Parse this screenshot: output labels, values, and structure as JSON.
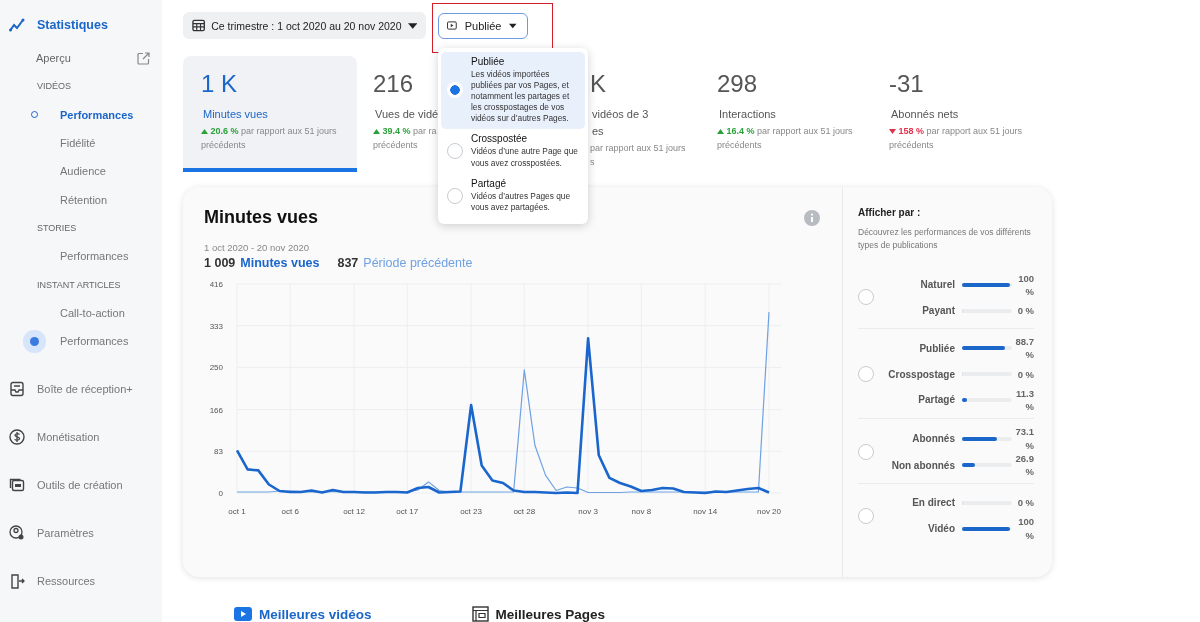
{
  "sidebar": {
    "title": "Statistiques",
    "items": [
      {
        "kind": "link",
        "label": "Aperçu"
      },
      {
        "kind": "section",
        "label": "VIDÉOS"
      },
      {
        "kind": "item",
        "label": "Performances",
        "selected": true,
        "highlighted": false
      },
      {
        "kind": "item",
        "label": "Fidélité",
        "selected": false,
        "highlighted": false
      },
      {
        "kind": "item",
        "label": "Audience",
        "selected": false,
        "highlighted": false
      },
      {
        "kind": "item",
        "label": "Rétention",
        "selected": false,
        "highlighted": false
      },
      {
        "kind": "section",
        "label": "STORIES"
      },
      {
        "kind": "item",
        "label": "Performances",
        "selected": false,
        "highlighted": false
      },
      {
        "kind": "section",
        "label": "INSTANT ARTICLES"
      },
      {
        "kind": "item",
        "label": "Call-to-action",
        "selected": false,
        "highlighted": false
      },
      {
        "kind": "item",
        "label": "Performances",
        "selected": false,
        "highlighted": true
      }
    ],
    "nav": [
      {
        "kind": "inbox",
        "label": "Boîte de réception+"
      },
      {
        "kind": "money",
        "label": "Monétisation"
      },
      {
        "kind": "tools",
        "label": "Outils de création"
      },
      {
        "kind": "settings",
        "label": "Paramètres"
      },
      {
        "kind": "resources",
        "label": "Ressources"
      }
    ]
  },
  "filters": {
    "date_range": "Ce trimestre : 1 oct 2020 au 20 nov 2020",
    "type": "Publiée",
    "type_annotated": true
  },
  "dropdown": {
    "options": [
      {
        "label": "Publiée",
        "description": "Les vidéos importées publiées par vos Pages, et notamment les partages et les crosspostages de vos vidéos sur d’autres Pages.",
        "selected": true
      },
      {
        "label": "Crosspostée",
        "description": "Vidéos d’une autre Page que vous avez crosspostées.",
        "selected": false
      },
      {
        "label": "Partagé",
        "description": "Vidéos d’autres Pages que vous avez partagées.",
        "selected": false
      }
    ]
  },
  "stats": [
    {
      "value": "1 K",
      "label": "Minutes vues",
      "change": "20.6 %",
      "positive": true,
      "note": "par rapport aux 51 jours",
      "note_2": "précédents",
      "selected": true
    },
    {
      "value": "216",
      "label": "Vues de vidé",
      "change": "39.4 %",
      "positive": true,
      "note": "par ra",
      "note_2": "précédents",
      "selected": false
    },
    {
      "value": "K",
      "label": "vidéos de 3",
      "label_2": "es",
      "note": "par rapport aux 51 jours",
      "note_2": "s",
      "selected": false,
      "covered": true
    },
    {
      "value": "298",
      "label": "Interactions",
      "change": "16.4 %",
      "positive": true,
      "note": "par rapport aux 51 jours",
      "note_2": "précédents",
      "selected": false
    },
    {
      "value": "-31",
      "label": "Abonnés nets",
      "change": "158 %",
      "positive": false,
      "note": "par rapport aux 51 jours",
      "note_2": "précédents",
      "selected": false
    }
  ],
  "chart_card": {
    "title": "Minutes vues",
    "period": "1 oct 2020 - 20 nov 2020",
    "total": "1 009",
    "previous": "837",
    "chart_data": {
      "type": "line",
      "grid": true,
      "categories": [
        "oct 1",
        null,
        null,
        null,
        null,
        "oct 6",
        null,
        null,
        null,
        null,
        null,
        "oct 12",
        null,
        null,
        null,
        null,
        "oct 17",
        null,
        null,
        null,
        null,
        null,
        "oct 23",
        null,
        null,
        null,
        null,
        "oct 28",
        null,
        null,
        null,
        null,
        null,
        "nov 3",
        null,
        null,
        null,
        null,
        "nov 8",
        null,
        null,
        null,
        null,
        null,
        "nov 14",
        null,
        null,
        null,
        null,
        null,
        "nov 20"
      ],
      "series": [
        {
          "name": "Minutes vues",
          "color": "#1a66cc",
          "values": [
            85,
            47,
            45,
            17,
            4,
            2,
            2,
            5,
            1,
            6,
            2,
            2,
            1,
            1,
            2,
            2,
            1,
            10,
            12,
            1,
            2,
            3,
            175,
            55,
            25,
            20,
            5,
            2,
            2,
            1,
            0,
            1,
            0,
            308,
            75,
            30,
            20,
            13,
            4,
            6,
            10,
            9,
            2,
            1,
            0,
            3,
            2,
            5,
            8,
            10,
            1
          ]
        },
        {
          "name": "Période précédente",
          "color": "#6fa1e3",
          "values": [
            2,
            2,
            2,
            2,
            4,
            4,
            3,
            2,
            2,
            3,
            2,
            2,
            2,
            2,
            3,
            2,
            2,
            6,
            22,
            5,
            2,
            2,
            2,
            2,
            2,
            2,
            2,
            245,
            95,
            35,
            5,
            12,
            10,
            1,
            1,
            1,
            1,
            2,
            2,
            2,
            2,
            2,
            2,
            2,
            2,
            2,
            2,
            2,
            2,
            2,
            360
          ]
        }
      ],
      "ylim": [
        0,
        416
      ],
      "yticks": [
        0,
        83,
        166,
        250,
        333,
        416
      ]
    }
  },
  "breakdown": {
    "title": "Afficher par :",
    "description": "Découvrez les performances de vos différents types de publications",
    "groups": [
      {
        "selected": false,
        "rows": [
          {
            "label": "Naturel",
            "level": 1,
            "value": "100 %"
          },
          {
            "label": "Payant",
            "level": 0,
            "value": "0 %"
          }
        ]
      },
      {
        "selected": false,
        "rows": [
          {
            "label": "Publiée",
            "level": 0.887,
            "value": "88.7 %"
          },
          {
            "label": "Crosspostage",
            "level": 0,
            "value": "0 %"
          },
          {
            "label": "Partagé",
            "level": 0.113,
            "value": "11.3 %"
          }
        ]
      },
      {
        "selected": false,
        "rows": [
          {
            "label": "Abonnés",
            "level": 0.731,
            "value": "73.1 %"
          },
          {
            "label": "Non abonnés",
            "level": 0.269,
            "value": "26.9 %"
          }
        ]
      },
      {
        "selected": false,
        "rows": [
          {
            "label": "En direct",
            "level": 0,
            "value": "0 %"
          },
          {
            "label": "Vidéo",
            "level": 1,
            "value": "100 %"
          }
        ]
      }
    ]
  },
  "sections": [
    {
      "kind": "videos",
      "label": "Meilleures vidéos"
    },
    {
      "kind": "pages",
      "label": "Meilleures Pages"
    }
  ]
}
